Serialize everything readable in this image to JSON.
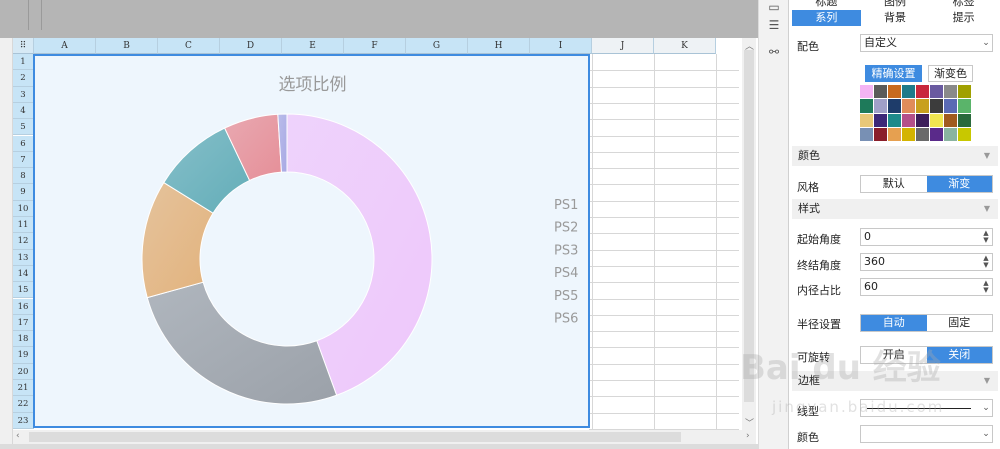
{
  "columns": [
    "A",
    "B",
    "C",
    "D",
    "E",
    "F",
    "G",
    "H",
    "I",
    "J",
    "K"
  ],
  "rows": [
    "1",
    "2",
    "3",
    "4",
    "5",
    "6",
    "7",
    "8",
    "9",
    "10",
    "11",
    "12",
    "13",
    "14",
    "15",
    "16",
    "17",
    "18",
    "19",
    "20",
    "21",
    "22",
    "23"
  ],
  "chart": {
    "title": "选项比例"
  },
  "chart_data": {
    "type": "pie",
    "style": "donut",
    "title": "选项比例",
    "categories": [
      "PS1",
      "PS2",
      "PS3",
      "PS4",
      "PS5",
      "PS6"
    ],
    "values": [
      44,
      26,
      13,
      9,
      6,
      1
    ],
    "colors": [
      "#eec7fb",
      "#9ba1a9",
      "#e2b27c",
      "#63adb8",
      "#e68f98",
      "#a8a9e4"
    ],
    "start_angle": 0,
    "end_angle": 360,
    "inner_radius_percent": 60,
    "legend": "right"
  },
  "panel": {
    "tabs_row1": [
      "标题",
      "图例",
      "标签"
    ],
    "tabs_row2": [
      "系列",
      "背景",
      "提示"
    ],
    "selected_tab": "系列",
    "color_label": "配色",
    "color_scheme": "自定义",
    "btn_precise": "精确设置",
    "btn_gradient": "渐变色",
    "swatch_colors": [
      "#f4b4f4",
      "#5a5a5a",
      "#c86a1e",
      "#1e7a8a",
      "#c8283c",
      "#6a5aa0",
      "#8a8a8a",
      "#a0a000",
      "#1e7a5a",
      "#a0a0c8",
      "#1e3c6a",
      "#e08c5a",
      "#c8a01e",
      "#3c3c3c",
      "#5a6ab4",
      "#5ab46a",
      "#e8c878",
      "#3c2878",
      "#1e8a8a",
      "#b4508a",
      "#3c1e5a",
      "#f0e650",
      "#a05a1e",
      "#2a6a3c",
      "#7890b4",
      "#8a1e2a",
      "#e6a050",
      "#d4b400",
      "#6a6a6a",
      "#5a2a8a",
      "#8ab4a0",
      "#c8c800"
    ],
    "sect_color": "颜色",
    "style_label": "风格",
    "style_default": "默认",
    "style_gradient": "渐变",
    "sect_style": "样式",
    "start_angle_label": "起始角度",
    "start_angle_value": "0",
    "end_angle_label": "终结角度",
    "end_angle_value": "360",
    "inner_ratio_label": "内径占比",
    "inner_ratio_value": "60",
    "radius_label": "半径设置",
    "radius_auto": "自动",
    "radius_fixed": "固定",
    "rotate_label": "可旋转",
    "rotate_on": "开启",
    "rotate_off": "关闭",
    "sect_border": "边框",
    "line_label": "线型",
    "color_label2": "颜色"
  },
  "watermark": {
    "logo": "Bai du 经验",
    "url": "jingyan.baidu.com"
  }
}
